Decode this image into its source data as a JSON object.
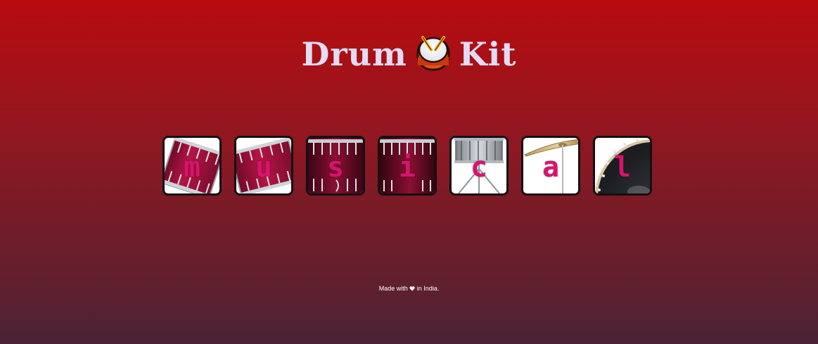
{
  "header": {
    "title_left": "Drum",
    "title_right": "Kit",
    "title_icon": "drum-emoji-icon"
  },
  "pads": [
    {
      "letter": "m",
      "instrument": "tom-1",
      "icon": "tom-drum-icon"
    },
    {
      "letter": "u",
      "instrument": "tom-2",
      "icon": "tom-drum-icon"
    },
    {
      "letter": "s",
      "instrument": "tom-3",
      "icon": "floor-tom-icon"
    },
    {
      "letter": "i",
      "instrument": "tom-4",
      "icon": "floor-tom-icon"
    },
    {
      "letter": "c",
      "instrument": "snare",
      "icon": "snare-drum-icon"
    },
    {
      "letter": "a",
      "instrument": "crash",
      "icon": "cymbal-icon"
    },
    {
      "letter": "l",
      "instrument": "kick",
      "icon": "bass-drum-icon"
    }
  ],
  "footer": {
    "before": "Made with",
    "after": "in India.",
    "icon": "heart-icon"
  },
  "colors": {
    "title": "#e2dcf4",
    "letter": "#d6146c",
    "background_top": "#b80b0e",
    "background_bottom": "#4b2335",
    "pad_border": "#141012"
  }
}
